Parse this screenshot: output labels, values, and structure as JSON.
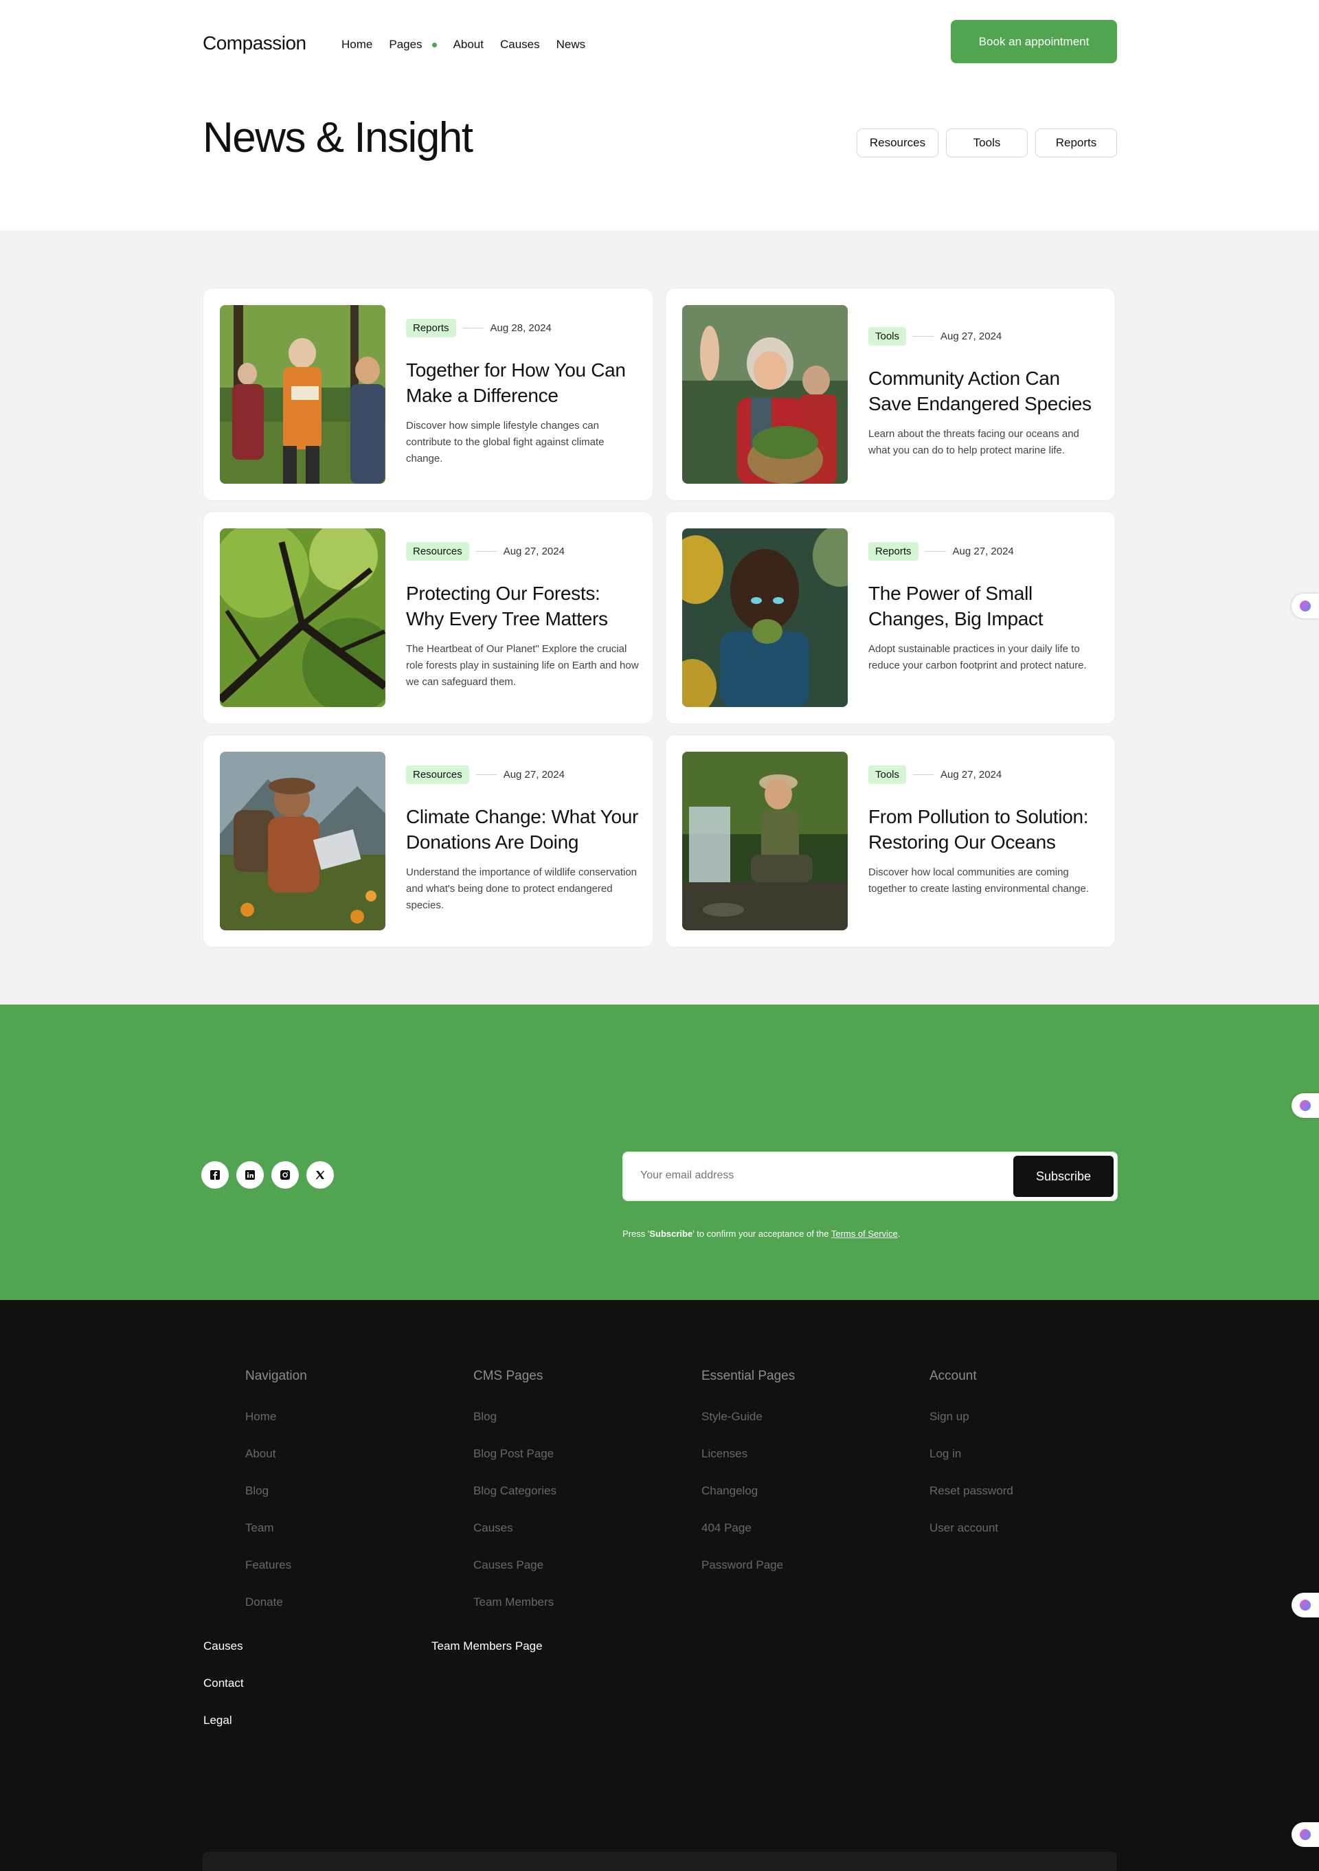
{
  "header": {
    "logo": "Compassion",
    "nav": [
      "Home",
      "Pages",
      "About",
      "Causes",
      "News"
    ],
    "cta": "Book an appointment"
  },
  "hero": {
    "title": "News & Insight",
    "filters": [
      "Resources",
      "Tools",
      "Reports"
    ]
  },
  "cards": [
    {
      "tag": "Reports",
      "date": "Aug 28, 2024",
      "title": "Together for How You Can Make a Difference",
      "desc": "Discover how simple lifestyle changes can contribute to the global fight against climate change."
    },
    {
      "tag": "Tools",
      "date": "Aug 27, 2024",
      "title": "Community Action Can Save Endangered Species",
      "desc": "Learn about the threats facing our oceans and what you can do to help protect marine life."
    },
    {
      "tag": "Resources",
      "date": "Aug 27, 2024",
      "title": "Protecting Our Forests: Why Every Tree Matters",
      "desc": "The Heartbeat of Our Planet\" Explore the crucial role forests play in sustaining life on Earth and how we can safeguard them."
    },
    {
      "tag": "Reports",
      "date": "Aug 27, 2024",
      "title": "The Power of Small Changes, Big Impact",
      "desc": "Adopt sustainable practices in your daily life to reduce your carbon footprint and protect nature."
    },
    {
      "tag": "Resources",
      "date": "Aug 27, 2024",
      "title": "Climate Change: What Your Donations Are Doing",
      "desc": "Understand the importance of wildlife conservation and what's being done to protect endangered species."
    },
    {
      "tag": "Tools",
      "date": "Aug 27, 2024",
      "title": "From Pollution to Solution: Restoring Our Oceans",
      "desc": "Discover how local communities are coming together to create lasting environmental change."
    }
  ],
  "newsletter": {
    "socials": [
      "facebook-icon",
      "linkedin-icon",
      "instagram-icon",
      "x-icon"
    ],
    "placeholder": "Your email address",
    "button": "Subscribe",
    "terms_prefix": "Press '",
    "terms_bold": "Subscribe",
    "terms_mid": "' to confirm your acceptance of the ",
    "terms_link": "Terms of Service",
    "terms_suffix": "."
  },
  "footer": {
    "columns": [
      {
        "title": "Navigation",
        "links": [
          "Home",
          "About",
          "Blog",
          "Team",
          "Features",
          "Donate"
        ]
      },
      {
        "title": "CMS Pages",
        "links": [
          "Blog",
          "Blog Post Page",
          "Blog Categories",
          "Causes",
          "Causes Page",
          "Team Members"
        ]
      },
      {
        "title": "Essential Pages",
        "links": [
          "Style-Guide",
          "Licenses",
          "Changelog",
          "404 Page",
          "Password Page"
        ]
      },
      {
        "title": "Account",
        "links": [
          "Sign up",
          "Log in",
          "Reset password",
          "User account"
        ]
      }
    ],
    "extra_left": [
      "Causes",
      "Contact",
      "Legal"
    ],
    "extra_mid": "Team Members Page"
  },
  "colors": {
    "accent": "#52a550",
    "tag_bg": "#d5f6d5",
    "footer_bg": "#111111"
  }
}
